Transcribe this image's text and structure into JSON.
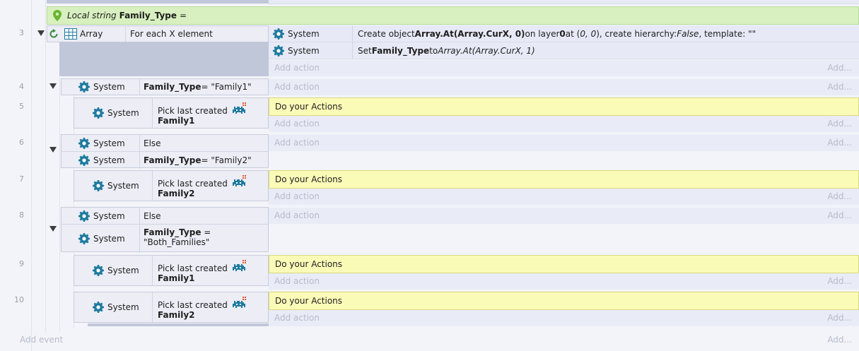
{
  "local_var": {
    "prefix": "Local string",
    "name": "Family_Type",
    "suffix": "="
  },
  "events": {
    "e3": {
      "line": "3",
      "object": "Array",
      "condition": "For each X element",
      "actions": [
        {
          "object": "System",
          "pre": "Create object ",
          "bold": "Array.At(Array.CurX, 0)",
          "mid": " on layer ",
          "bold2": "0",
          "mid2": " at (",
          "italic": "0, 0",
          "mid3": "), create hierarchy: ",
          "italic2": "False",
          "post": ", template: \"\""
        },
        {
          "object": "System",
          "pre": "Set ",
          "bold": "Family_Type",
          "mid": " to ",
          "italic": "Array.At(Array.CurX, 1)"
        }
      ]
    },
    "e4": {
      "line": "4",
      "object": "System",
      "bold": "Family_Type",
      "rest": " = \"Family1\""
    },
    "e5": {
      "line": "5",
      "object": "System",
      "pick": "Pick last created",
      "family": "Family1",
      "action": "Do your Actions"
    },
    "e6": {
      "line": "6",
      "object": "System",
      "else": "Else",
      "object2": "System",
      "bold": "Family_Type",
      "rest": " = \"Family2\""
    },
    "e7": {
      "line": "7",
      "object": "System",
      "pick": "Pick last created",
      "family": "Family2",
      "action": "Do your Actions"
    },
    "e8": {
      "line": "8",
      "object": "System",
      "else": "Else",
      "object2": "System",
      "bold": "Family_Type",
      "rest": " =",
      "rest2": "\"Both_Families\""
    },
    "e9": {
      "line": "9",
      "object": "System",
      "pick": "Pick last created",
      "family": "Family1",
      "action": "Do your Actions"
    },
    "e10": {
      "line": "10",
      "object": "System",
      "pick": "Pick last created",
      "family": "Family2",
      "action": "Do your Actions"
    }
  },
  "labels": {
    "add_action": "Add action",
    "add_more": "Add...",
    "add_event": "Add event"
  },
  "colors": {
    "gear": "#1f7a9e",
    "yellow": "#fbfbb8",
    "green": "#d8f0c0"
  }
}
